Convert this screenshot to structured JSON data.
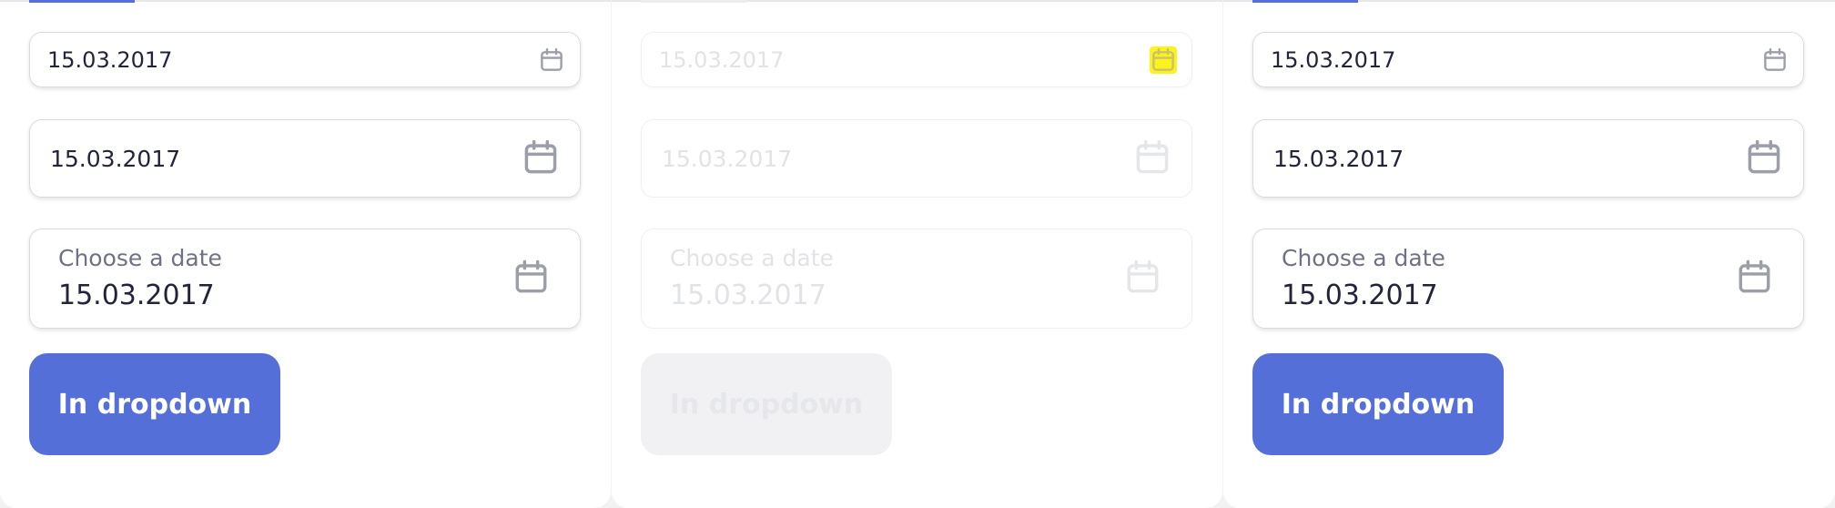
{
  "variants": [
    {
      "state": "enabled",
      "compact_field": {
        "value": "15.03.2017",
        "icon": "calendar-icon"
      },
      "medium_field": {
        "value": "15.03.2017",
        "icon": "calendar-icon"
      },
      "labeled_field": {
        "label": "Choose a date",
        "value": "15.03.2017",
        "icon": "calendar-icon"
      },
      "dropdown_button": {
        "label": "In dropdown"
      }
    },
    {
      "state": "disabled",
      "compact_field": {
        "value": "15.03.2017",
        "icon": "calendar-icon"
      },
      "medium_field": {
        "value": "15.03.2017",
        "icon": "calendar-icon"
      },
      "labeled_field": {
        "label": "Choose a date",
        "value": "15.03.2017",
        "icon": "calendar-icon"
      },
      "dropdown_button": {
        "label": "In dropdown"
      }
    },
    {
      "state": "enabled",
      "compact_field": {
        "value": "15.03.2017",
        "icon": "calendar-icon"
      },
      "medium_field": {
        "value": "15.03.2017",
        "icon": "calendar-icon"
      },
      "labeled_field": {
        "label": "Choose a date",
        "value": "15.03.2017",
        "icon": "calendar-icon"
      },
      "dropdown_button": {
        "label": "In dropdown"
      }
    }
  ],
  "colors": {
    "accent": "#5470d8",
    "text": "#22253a",
    "label": "#6f7184",
    "icon": "#9c9ea9",
    "disabled_text": "#e2e3e7",
    "disabled_icon": "#e5e6ea",
    "disabled_icon_highlight": "#fbf21e"
  }
}
